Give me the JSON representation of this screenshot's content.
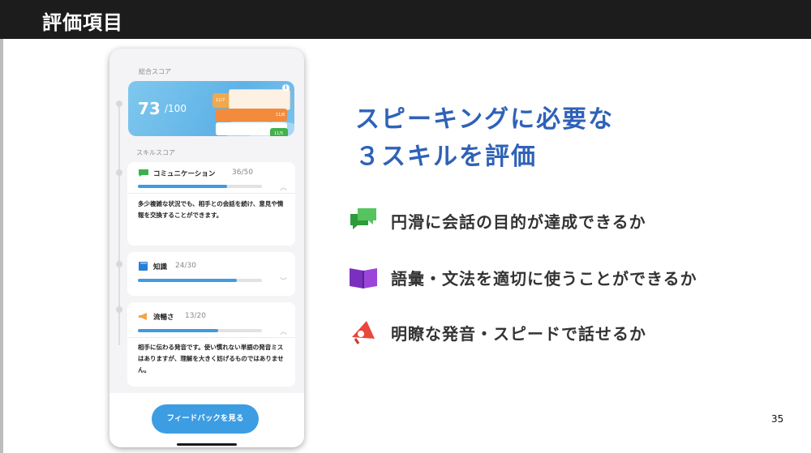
{
  "slide": {
    "title": "評価項目",
    "page_number": "35"
  },
  "phone": {
    "total_label": "総合スコア",
    "total_score": "73",
    "total_max": "/100",
    "deco_labels": [
      "11/7",
      "11/8",
      "11/5"
    ],
    "skill_label": "スキルスコア",
    "skills": [
      {
        "name": "コミュニケーション",
        "score": "36/50",
        "progress": 0.72,
        "expanded": true,
        "description": "多少複雑な状況でも、相手との会話を続け、意見や情報を交換することができます。"
      },
      {
        "name": "知識",
        "score": "24/30",
        "progress": 0.8,
        "expanded": false,
        "description": ""
      },
      {
        "name": "流暢さ",
        "score": "13/20",
        "progress": 0.65,
        "expanded": true,
        "description": "相手に伝わる発音です。使い慣れない単語の発音ミスはありますが、理解を大きく妨げるものではありません。"
      }
    ],
    "feedback_button": "フィードバックを見る"
  },
  "headline": {
    "line1": "スピーキングに必要な",
    "line2": " ３スキルを評価"
  },
  "bullets": [
    {
      "icon": "speech-bubbles-icon",
      "text": "円滑に会話の目的が達成できるか"
    },
    {
      "icon": "book-icon",
      "text": "語彙・文法を適切に使うことができるか"
    },
    {
      "icon": "megaphone-icon",
      "text": "明瞭な発音・スピードで話せるか"
    }
  ],
  "colors": {
    "accent_blue": "#2f62b7",
    "progress_blue": "#3f9be2",
    "button_blue": "#3c9de3"
  }
}
